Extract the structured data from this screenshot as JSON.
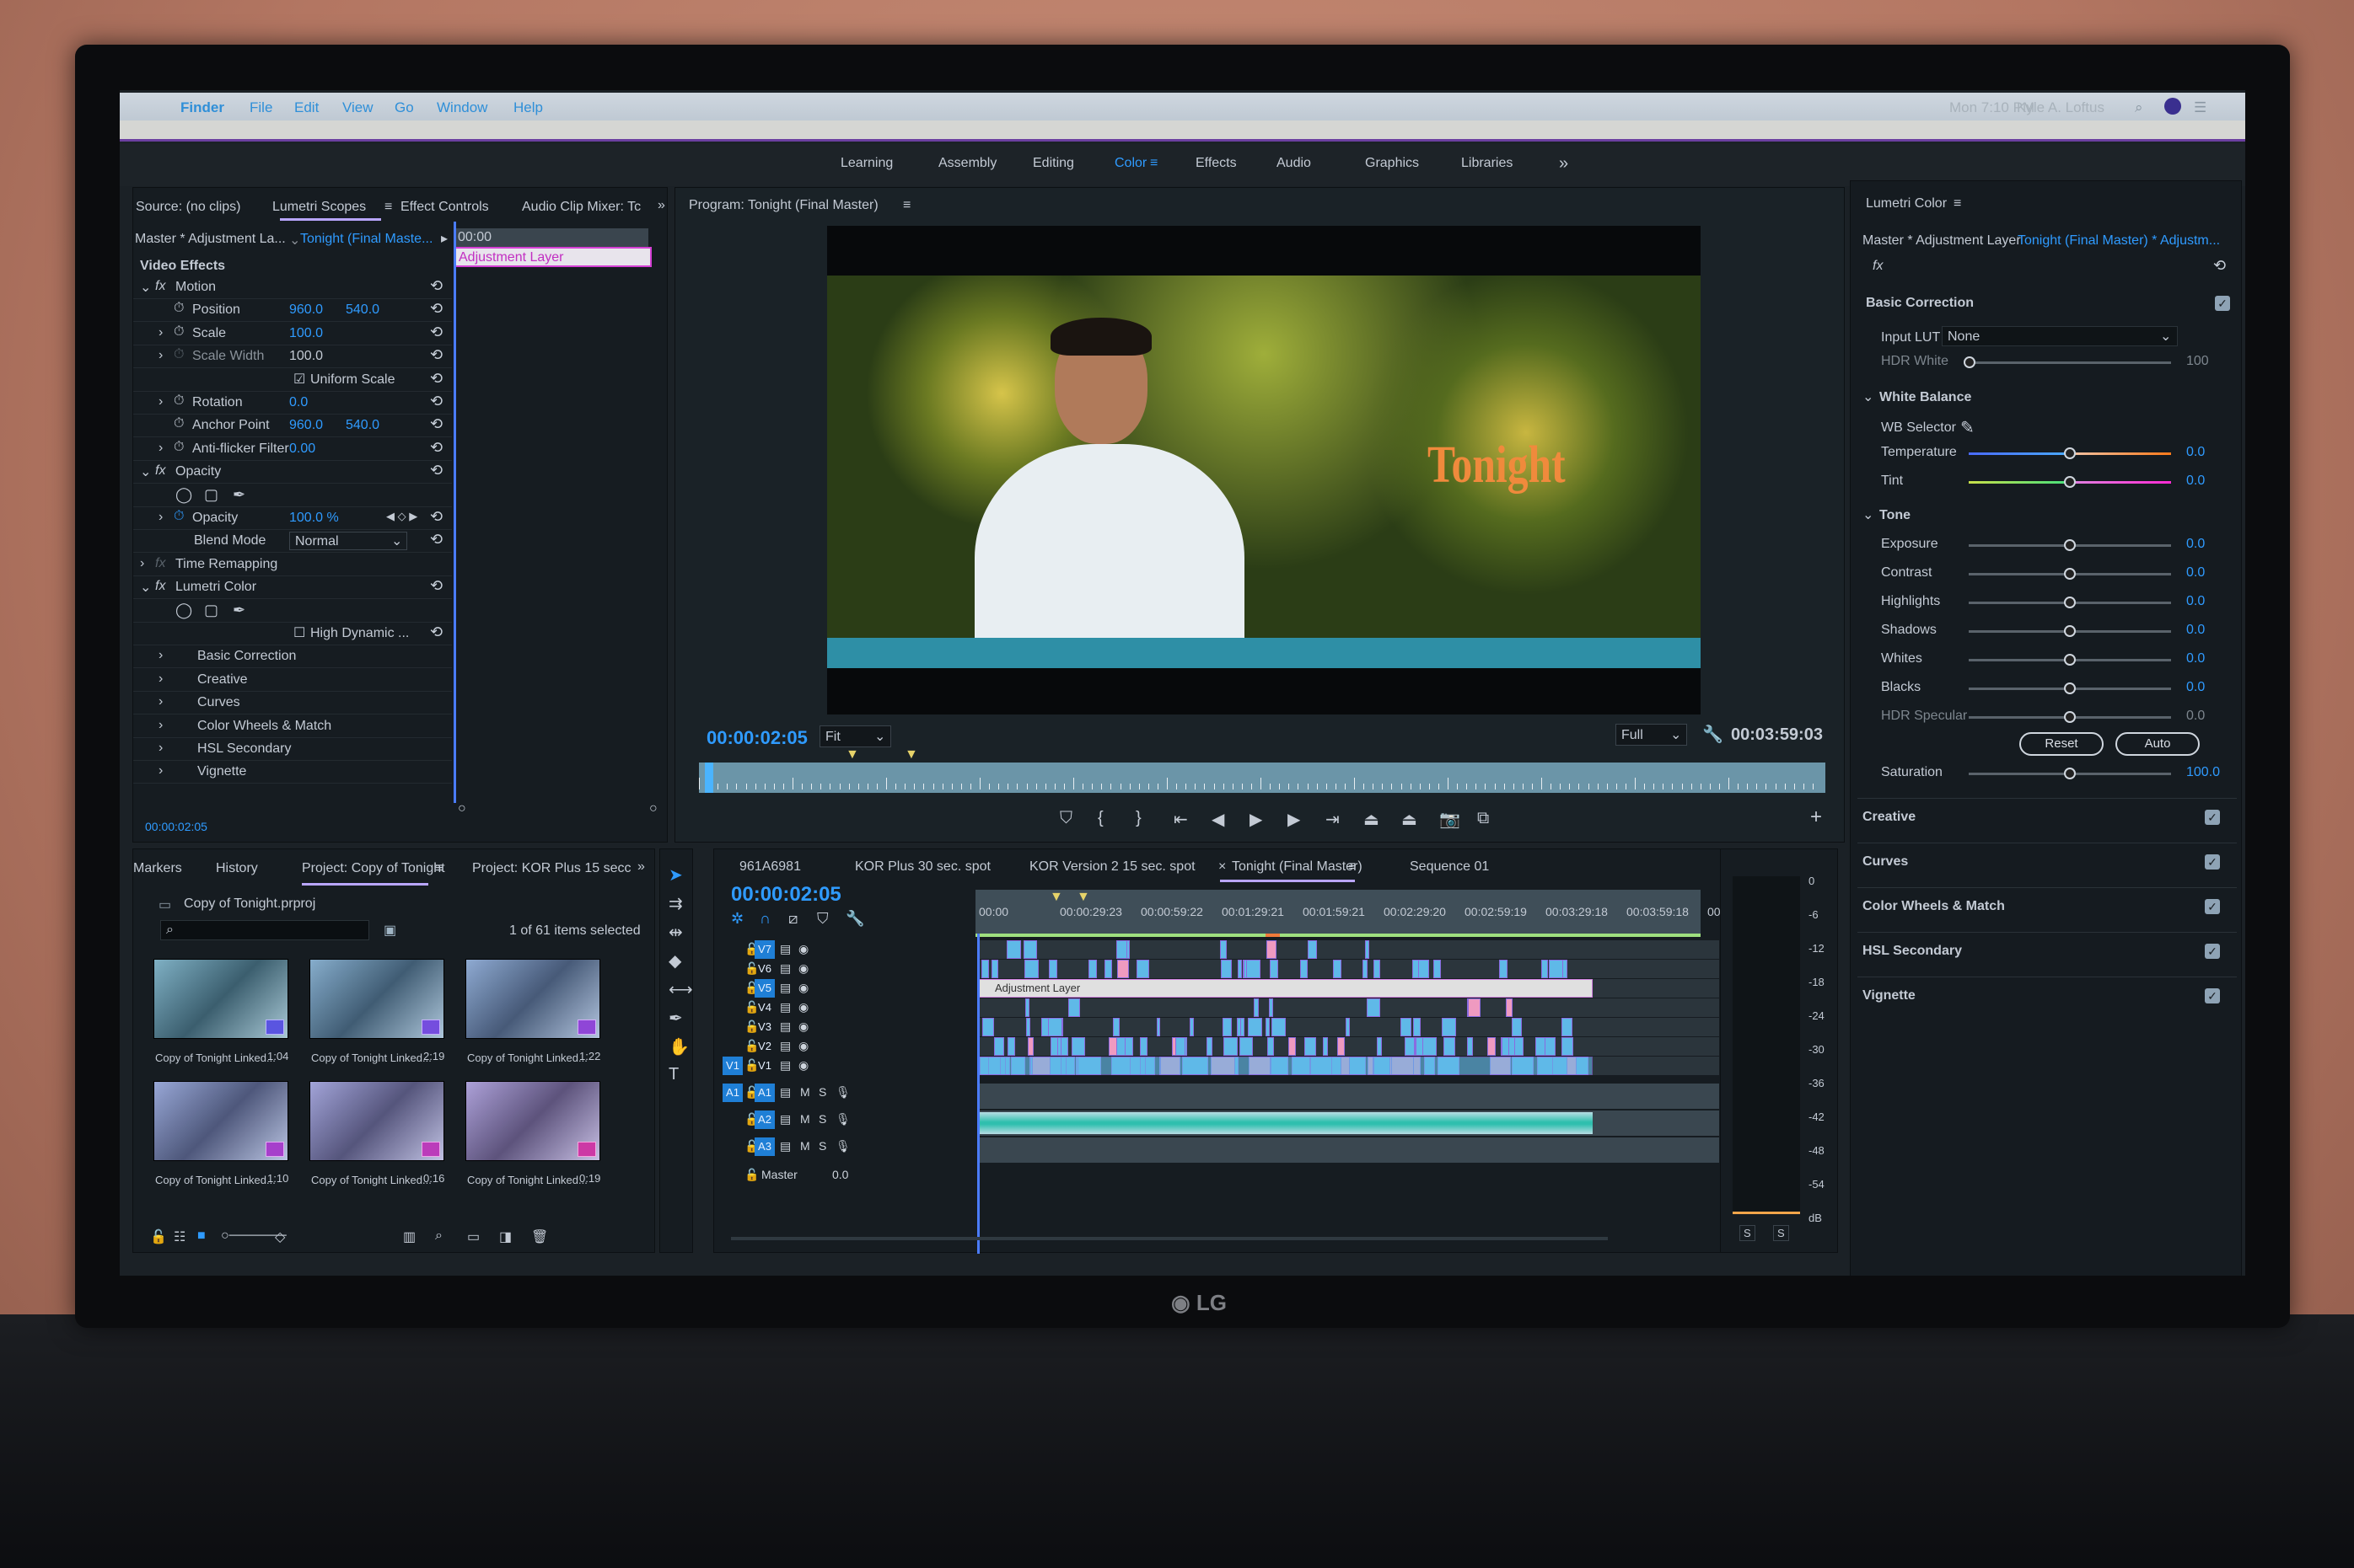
{
  "menubar": {
    "items": [
      "Finder",
      "File",
      "Edit",
      "View",
      "Go",
      "Window",
      "Help"
    ],
    "clock": "Mon 7:10 PM",
    "user": "Kyle A. Loftus"
  },
  "workspaces": {
    "items": [
      "Learning",
      "Assembly",
      "Editing",
      "Color",
      "Effects",
      "Audio",
      "Graphics",
      "Libraries"
    ],
    "active": "Color",
    "more": "»"
  },
  "effect_panel": {
    "tabs": [
      "Source: (no clips)",
      "Lumetri Scopes",
      "Effect Controls",
      "Audio Clip Mixer: Tc"
    ],
    "more": "»",
    "master": "Master * Adjustment La...",
    "sequence": "Tonight (Final Maste...",
    "ruler_start": "00:00",
    "clip_label": "Adjustment Layer",
    "section": "Video Effects",
    "rows": [
      {
        "indent": 0,
        "arrow": "⌄",
        "fx": true,
        "label": "Motion",
        "v1": "",
        "v2": "",
        "reset": true
      },
      {
        "indent": 1,
        "arrow": "",
        "stopwatch": true,
        "label": "Position",
        "v1": "960.0",
        "v2": "540.0",
        "reset": true
      },
      {
        "indent": 1,
        "arrow": "›",
        "stopwatch": true,
        "label": "Scale",
        "v1": "100.0",
        "v2": "",
        "reset": true
      },
      {
        "indent": 1,
        "arrow": "›",
        "stopwatch": true,
        "dim": true,
        "label": "Scale Width",
        "v1": "100.0",
        "v2": "",
        "reset": true,
        "plain": true
      },
      {
        "indent": 2,
        "checkbox": true,
        "label": "Uniform Scale",
        "reset": true
      },
      {
        "indent": 1,
        "arrow": "›",
        "stopwatch": true,
        "label": "Rotation",
        "v1": "0.0",
        "v2": "",
        "reset": true
      },
      {
        "indent": 1,
        "arrow": "",
        "stopwatch": true,
        "label": "Anchor Point",
        "v1": "960.0",
        "v2": "540.0",
        "reset": true
      },
      {
        "indent": 1,
        "arrow": "›",
        "stopwatch": true,
        "label": "Anti-flicker Filter",
        "v1": "0.00",
        "v2": "",
        "reset": true
      },
      {
        "indent": 0,
        "arrow": "⌄",
        "fx": true,
        "label": "Opacity",
        "reset": true
      },
      {
        "indent": 1,
        "masks": true
      },
      {
        "indent": 1,
        "arrow": "›",
        "stopwatch": true,
        "label": "Opacity",
        "v1": "100.0 %",
        "v2": "",
        "reset": true,
        "keyframes": true
      },
      {
        "indent": 1,
        "label": "Blend Mode",
        "select": "Normal",
        "reset": true
      },
      {
        "indent": 0,
        "arrow": "›",
        "fx": true,
        "dimfx": true,
        "label": "Time Remapping"
      },
      {
        "indent": 0,
        "arrow": "⌄",
        "fx": true,
        "label": "Lumetri Color",
        "reset": true
      },
      {
        "indent": 1,
        "masks": true
      },
      {
        "indent": 2,
        "checkbox": true,
        "unchecked": true,
        "label": "High Dynamic ...",
        "reset": true
      },
      {
        "indent": 1,
        "arrow": "›",
        "sub": true,
        "label": "Basic Correction"
      },
      {
        "indent": 1,
        "arrow": "›",
        "sub": true,
        "label": "Creative"
      },
      {
        "indent": 1,
        "arrow": "›",
        "sub": true,
        "label": "Curves"
      },
      {
        "indent": 1,
        "arrow": "›",
        "sub": true,
        "label": "Color Wheels & Match"
      },
      {
        "indent": 1,
        "arrow": "›",
        "sub": true,
        "label": "HSL Secondary"
      },
      {
        "indent": 1,
        "arrow": "›",
        "sub": true,
        "label": "Vignette"
      }
    ],
    "timecode": "00:00:02:05"
  },
  "program": {
    "title": "Program: Tonight (Final Master)",
    "overlay_title": "Tonight",
    "timecode": "00:00:02:05",
    "fit": "Fit",
    "quality": "Full",
    "duration": "00:03:59:03",
    "playhead_fraction": 0.005
  },
  "lumetri": {
    "title": "Lumetri Color",
    "master": "Master * Adjustment Layer",
    "sequence": "Tonight (Final Master) * Adjustm...",
    "fx": "fx",
    "basic": "Basic Correction",
    "input_lut_label": "Input LUT",
    "input_lut": "None",
    "hdr_white": {
      "label": "HDR White",
      "value": "100"
    },
    "white_balance": "White Balance",
    "wb_selector": "WB Selector",
    "temperature": {
      "label": "Temperature",
      "value": "0.0"
    },
    "tint": {
      "label": "Tint",
      "value": "0.0"
    },
    "tone": "Tone",
    "tone_sliders": [
      {
        "label": "Exposure",
        "value": "0.0"
      },
      {
        "label": "Contrast",
        "value": "0.0"
      },
      {
        "label": "Highlights",
        "value": "0.0"
      },
      {
        "label": "Shadows",
        "value": "0.0"
      },
      {
        "label": "Whites",
        "value": "0.0"
      },
      {
        "label": "Blacks",
        "value": "0.0"
      },
      {
        "label": "HDR Specular",
        "value": "0.0",
        "dim": true
      }
    ],
    "reset": "Reset",
    "auto": "Auto",
    "saturation": {
      "label": "Saturation",
      "value": "100.0"
    },
    "sections": [
      {
        "label": "Creative",
        "checked": true
      },
      {
        "label": "Curves",
        "checked": true
      },
      {
        "label": "Color Wheels & Match",
        "checked": true
      },
      {
        "label": "HSL Secondary",
        "checked": true
      },
      {
        "label": "Vignette",
        "checked": true
      }
    ]
  },
  "project": {
    "tabs": [
      "Markers",
      "History",
      "Project: Copy of Tonight",
      "Project: KOR Plus 15 secc"
    ],
    "more": "»",
    "file": "Copy of Tonight.prproj",
    "search_placeholder": "",
    "selection": "1 of 61 items selected",
    "items": [
      {
        "name": "Copy of Tonight Linked...",
        "duration": "1:04"
      },
      {
        "name": "Copy of Tonight Linked...",
        "duration": "2:19"
      },
      {
        "name": "Copy of Tonight Linked...",
        "duration": "1:22"
      },
      {
        "name": "Copy of Tonight Linked...",
        "duration": "1:10"
      },
      {
        "name": "Copy of Tonight Linked...",
        "duration": "0:16"
      },
      {
        "name": "Copy of Tonight Linked...",
        "duration": "0:19"
      }
    ]
  },
  "timeline": {
    "tabs": [
      "961A6981",
      "KOR Plus 30 sec. spot",
      "KOR Version 2 15 sec. spot",
      "Tonight (Final Master)",
      "Sequence 01"
    ],
    "active": "Tonight (Final Master)",
    "timecode": "00:00:02:05",
    "ruler": [
      "00:00",
      "00:00:29:23",
      "00:00:59:22",
      "00:01:29:21",
      "00:01:59:21",
      "00:02:29:20",
      "00:02:59:19",
      "00:03:29:18",
      "00:03:59:18",
      "00"
    ],
    "video_tracks": [
      "V7",
      "V6",
      "V5",
      "V4",
      "V3",
      "V2",
      "V1"
    ],
    "source_patch_video": "V1",
    "audio_tracks": [
      "A1",
      "A2",
      "A3"
    ],
    "source_patch_audio": "A1",
    "mute": "M",
    "solo": "S",
    "master": {
      "label": "Master",
      "value": "0.0"
    },
    "adjustment_clip": "Adjustment Layer"
  },
  "audio_meter": {
    "scale": [
      "0",
      "-6",
      "-12",
      "-18",
      "-24",
      "-30",
      "-36",
      "-42",
      "-48",
      "-54",
      "dB"
    ],
    "solo": [
      "S",
      "S"
    ]
  },
  "monitor_brand": "LG",
  "colors": {
    "accent": "#2f9bff",
    "clip_video": "#5fb9e8",
    "clip_pink": "#ef9ac0",
    "adjustment": "#e0e0e0",
    "audio": "#2fbfae",
    "title_orange": "#f08a3c"
  }
}
